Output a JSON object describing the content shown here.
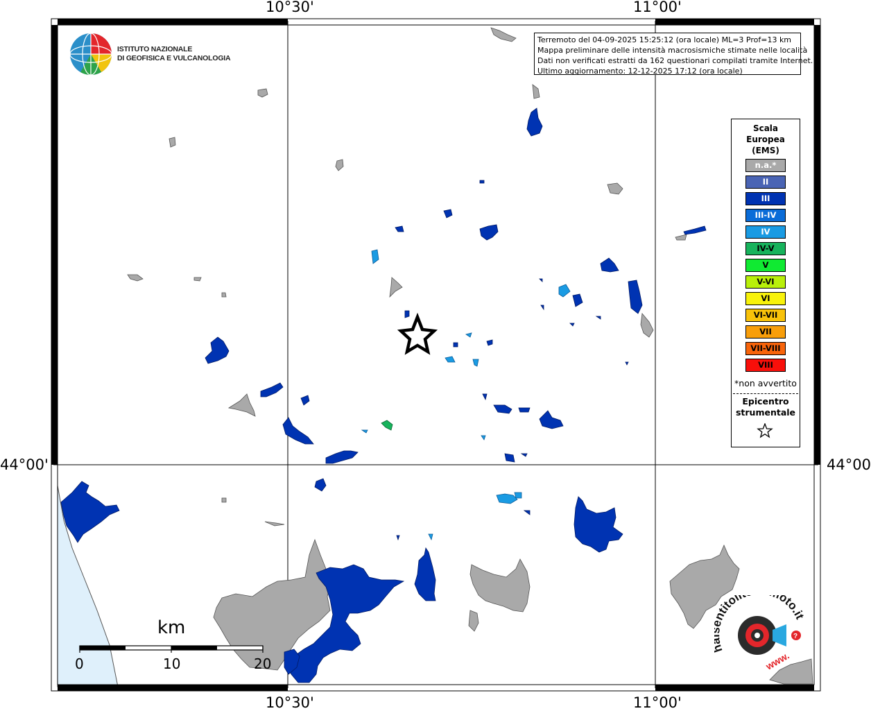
{
  "map": {
    "coords": {
      "top": [
        "10°30'",
        "11°00'"
      ],
      "bottom": [
        "10°30'",
        "11°00'"
      ],
      "left": "44°00'",
      "right": "44°00'"
    },
    "info_lines": [
      "Terremoto del 04-09-2025 15:25:12 (ora locale) ML=3 Prof=13 km",
      "Mappa preliminare delle intensità macrosismiche stimate nelle località",
      "Dati non verificati estratti da 162 questionari compilati tramite Internet.",
      "Ultimo aggiornamento: 12-12-2025 17:12 (ora locale)"
    ],
    "colors": {
      "sea": "#dff0fb",
      "gray_area": "#a9a9a9",
      "blue_area": "#0033b2"
    }
  },
  "logo": {
    "line1": "ISTITUTO NAZIONALE",
    "line2": "DI GEOFISICA E VULCANOLOGIA"
  },
  "legend": {
    "title": [
      "Scala",
      "Europea",
      "(EMS)"
    ],
    "items": [
      {
        "label": "n.a.*",
        "color": "#a9a9a9"
      },
      {
        "label": "II",
        "color": "#4a64b4"
      },
      {
        "label": "III",
        "color": "#0033b2"
      },
      {
        "label": "III-IV",
        "color": "#0a6cd8"
      },
      {
        "label": "IV",
        "color": "#1a9be3"
      },
      {
        "label": "IV-V",
        "color": "#17b35c"
      },
      {
        "label": "V",
        "color": "#10ea32"
      },
      {
        "label": "V-VI",
        "color": "#b9f00a"
      },
      {
        "label": "VI",
        "color": "#f8f20a"
      },
      {
        "label": "VI-VII",
        "color": "#f8c20a"
      },
      {
        "label": "VII",
        "color": "#f89e0a"
      },
      {
        "label": "VII-VIII",
        "color": "#f8640a"
      },
      {
        "label": "VIII",
        "color": "#f80f0a"
      }
    ],
    "note": "*non avvertito",
    "epicenter_label": [
      "Epicentro",
      "strumentale"
    ]
  },
  "scale_bar": {
    "title": "km",
    "labels": [
      "0",
      "10",
      "20"
    ]
  },
  "hsi_logo": {
    "text": "haisentitoilterremoto.it",
    "www": "www."
  }
}
